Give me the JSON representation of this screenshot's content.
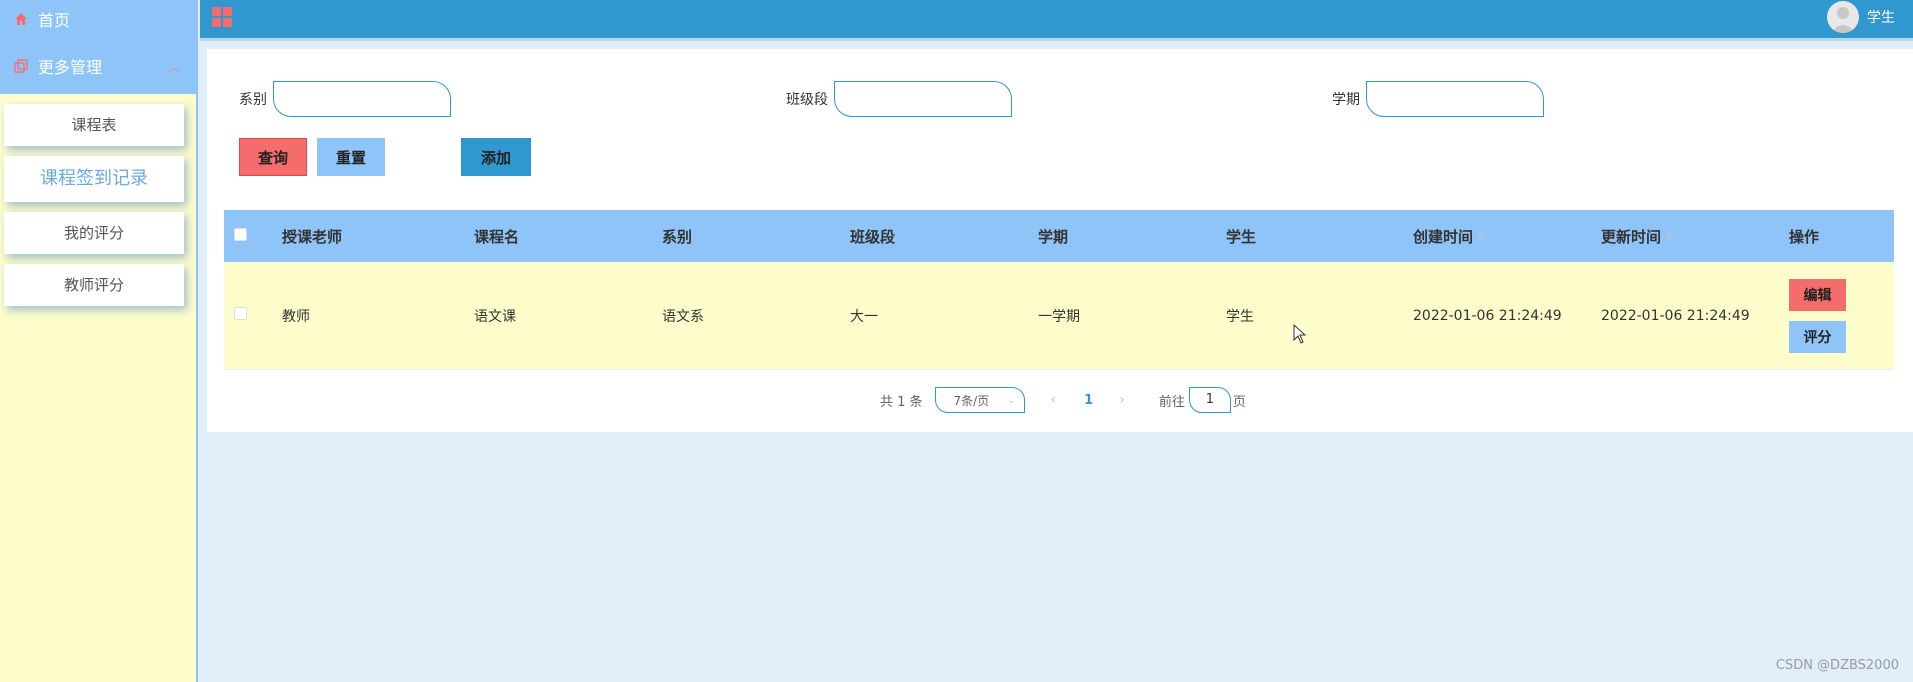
{
  "sidebar": {
    "home": "首页",
    "more": "更多管理",
    "items": [
      "课程表",
      "课程签到记录",
      "我的评分",
      "教师评分"
    ]
  },
  "topbar": {
    "user": "学生"
  },
  "filters": {
    "dept_label": "系别",
    "grade_label": "班级段",
    "term_label": "学期"
  },
  "buttons": {
    "query": "查询",
    "reset": "重置",
    "add": "添加"
  },
  "table": {
    "headers": [
      "授课老师",
      "课程名",
      "系别",
      "班级段",
      "学期",
      "学生",
      "创建时间",
      "更新时间",
      "操作"
    ],
    "rows": [
      [
        "教师",
        "语文课",
        "语文系",
        "大一",
        "一学期",
        "学生",
        "2022-01-06 21:24:49",
        "2022-01-06 21:24:49"
      ]
    ],
    "actions": {
      "edit": "编辑",
      "rate": "评分"
    }
  },
  "pagination": {
    "total": "共 1 条",
    "page_size": "7条/页",
    "current_page": "1",
    "goto_prefix": "前往",
    "goto_value": "1",
    "goto_suffix": "页"
  },
  "watermark": "CSDN @DZBS2000",
  "colors": {
    "primary": "#3197cf",
    "light_blue": "#8fc4f9",
    "danger": "#f56c6c",
    "row_bg": "#fdfdcc",
    "page_bg": "#e1effb"
  }
}
